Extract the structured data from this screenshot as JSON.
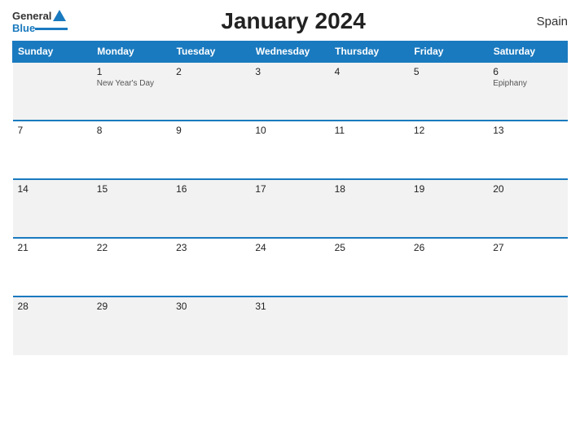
{
  "header": {
    "logo_general": "General",
    "logo_blue": "Blue",
    "title": "January 2024",
    "country": "Spain"
  },
  "weekdays": [
    "Sunday",
    "Monday",
    "Tuesday",
    "Wednesday",
    "Thursday",
    "Friday",
    "Saturday"
  ],
  "weeks": [
    [
      {
        "day": "",
        "holiday": ""
      },
      {
        "day": "1",
        "holiday": "New Year's Day"
      },
      {
        "day": "2",
        "holiday": ""
      },
      {
        "day": "3",
        "holiday": ""
      },
      {
        "day": "4",
        "holiday": ""
      },
      {
        "day": "5",
        "holiday": ""
      },
      {
        "day": "6",
        "holiday": "Epiphany"
      }
    ],
    [
      {
        "day": "7",
        "holiday": ""
      },
      {
        "day": "8",
        "holiday": ""
      },
      {
        "day": "9",
        "holiday": ""
      },
      {
        "day": "10",
        "holiday": ""
      },
      {
        "day": "11",
        "holiday": ""
      },
      {
        "day": "12",
        "holiday": ""
      },
      {
        "day": "13",
        "holiday": ""
      }
    ],
    [
      {
        "day": "14",
        "holiday": ""
      },
      {
        "day": "15",
        "holiday": ""
      },
      {
        "day": "16",
        "holiday": ""
      },
      {
        "day": "17",
        "holiday": ""
      },
      {
        "day": "18",
        "holiday": ""
      },
      {
        "day": "19",
        "holiday": ""
      },
      {
        "day": "20",
        "holiday": ""
      }
    ],
    [
      {
        "day": "21",
        "holiday": ""
      },
      {
        "day": "22",
        "holiday": ""
      },
      {
        "day": "23",
        "holiday": ""
      },
      {
        "day": "24",
        "holiday": ""
      },
      {
        "day": "25",
        "holiday": ""
      },
      {
        "day": "26",
        "holiday": ""
      },
      {
        "day": "27",
        "holiday": ""
      }
    ],
    [
      {
        "day": "28",
        "holiday": ""
      },
      {
        "day": "29",
        "holiday": ""
      },
      {
        "day": "30",
        "holiday": ""
      },
      {
        "day": "31",
        "holiday": ""
      },
      {
        "day": "",
        "holiday": ""
      },
      {
        "day": "",
        "holiday": ""
      },
      {
        "day": "",
        "holiday": ""
      }
    ]
  ]
}
